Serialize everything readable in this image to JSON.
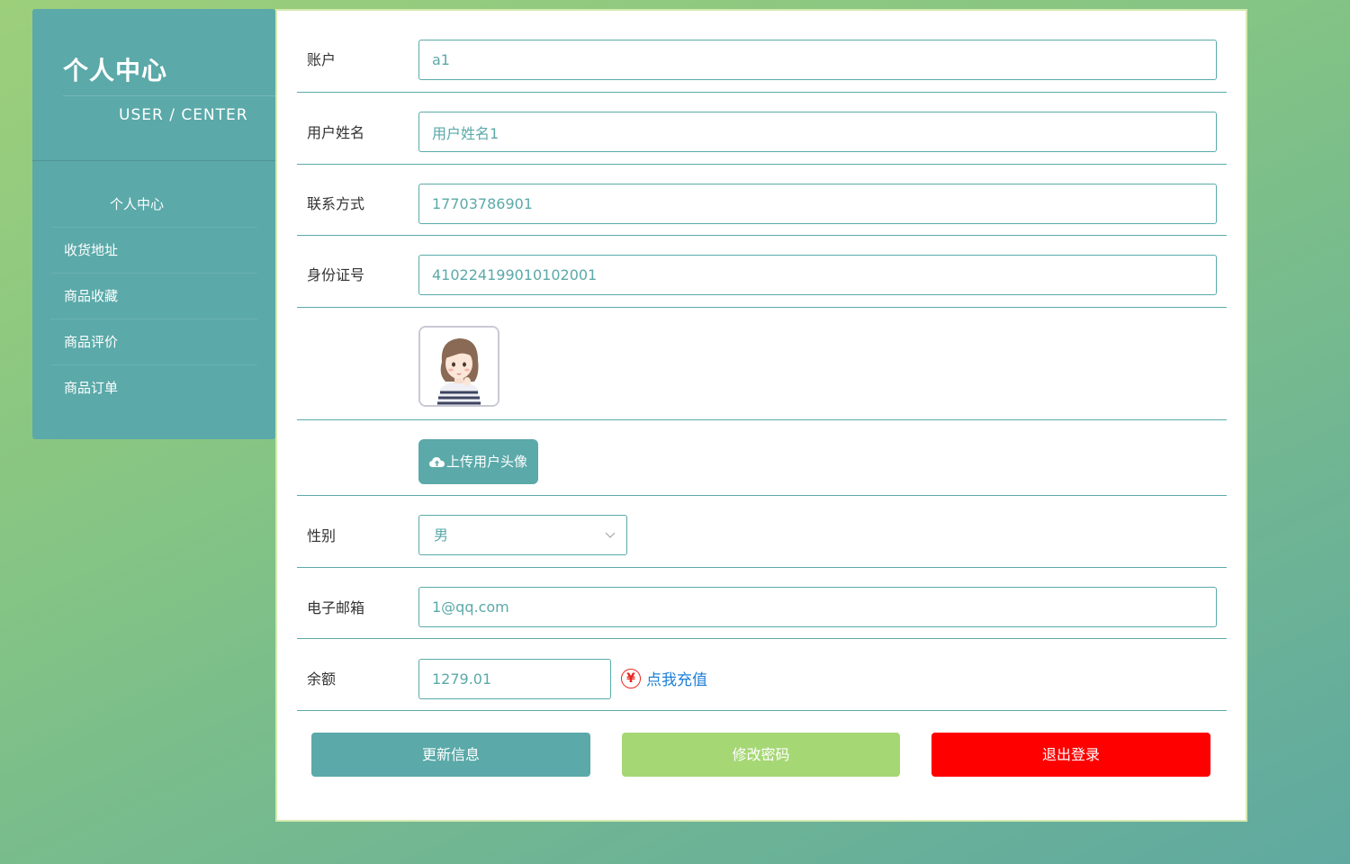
{
  "sidebar": {
    "title": "个人中心",
    "subtitle": "USER / CENTER",
    "items": [
      {
        "label": "个人中心"
      },
      {
        "label": "收货地址"
      },
      {
        "label": "商品收藏"
      },
      {
        "label": "商品评价"
      },
      {
        "label": "商品订单"
      }
    ]
  },
  "form": {
    "account": {
      "label": "账户",
      "value": "a1"
    },
    "username": {
      "label": "用户姓名",
      "value": "用户姓名1"
    },
    "phone": {
      "label": "联系方式",
      "value": "17703786901"
    },
    "id_number": {
      "label": "身份证号",
      "value": "410224199010102001"
    },
    "upload_label": "上传用户头像",
    "gender": {
      "label": "性别",
      "value": "男"
    },
    "email": {
      "label": "电子邮箱",
      "value": "1@qq.com"
    },
    "balance": {
      "label": "余额",
      "value": "1279.01",
      "recharge_label": "点我充值",
      "currency_symbol": "¥"
    }
  },
  "actions": {
    "update_label": "更新信息",
    "password_label": "修改密码",
    "logout_label": "退出登录"
  },
  "colors": {
    "primary": "#5ba9a9",
    "secondary": "#a6d775",
    "danger": "#ff0000",
    "link": "#1e7fd6"
  }
}
